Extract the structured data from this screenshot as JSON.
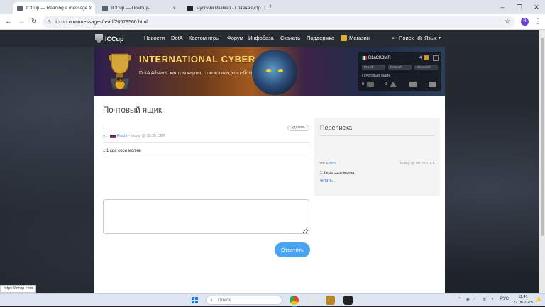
{
  "browser": {
    "tabs": [
      {
        "title": "ICCup — Reading a message fr",
        "active": true
      },
      {
        "title": "ICCup — Помощь",
        "active": false
      },
      {
        "title": "Русский Размер - Главная стр",
        "active": false
      }
    ],
    "new_tab": "+",
    "url": "iccup.com/messages/read/26579560.html",
    "profile_initial": "R",
    "status_url": "https://iccup.com"
  },
  "site": {
    "logo": "ICCup",
    "nav": [
      "Новости",
      "DotA",
      "Кастом игры",
      "Форум",
      "Инфобаза",
      "Скачать",
      "Поддержка",
      "Магазин"
    ],
    "search_label": "Поиск",
    "language_label": "Язык"
  },
  "banner": {
    "title": "INTERNATIONAL CYBER CUP",
    "subtitle": "DotA Allstars: кастом карты, статистика, хост-боты",
    "level": "63"
  },
  "user_panel": {
    "username": "B1aCK3taR",
    "count": "4",
    "pills": [
      "Pro:off",
      "Dota:off",
      "Bonus:off"
    ],
    "mailbox_label": "Почтовый ящик",
    "mail_count": "0",
    "warn_count": "0"
  },
  "mailbox": {
    "title": "Почтовый ящик",
    "subject": ".",
    "delete_label": "удалить",
    "from_prefix": "от:",
    "from_user": "Fischi",
    "separator": "-",
    "time": "today @ 08:35 CET",
    "body": "1:1 кда соси молча",
    "reply_label": "Ответить"
  },
  "conversation": {
    "title": "Переписка",
    "from_prefix": "от:",
    "from_user": "Fischi",
    "time": "today @ 08:35 CET",
    "preview": "1:1 кда соси молча",
    "read_link": "читать..."
  },
  "taskbar": {
    "search_placeholder": "Поиск",
    "language": "РУС",
    "time": "11:41",
    "date": "22.06.2025"
  },
  "colors": {
    "accent": "#4aa3f0",
    "link": "#3a7bd5",
    "site_nav_bg": "#262a31"
  }
}
